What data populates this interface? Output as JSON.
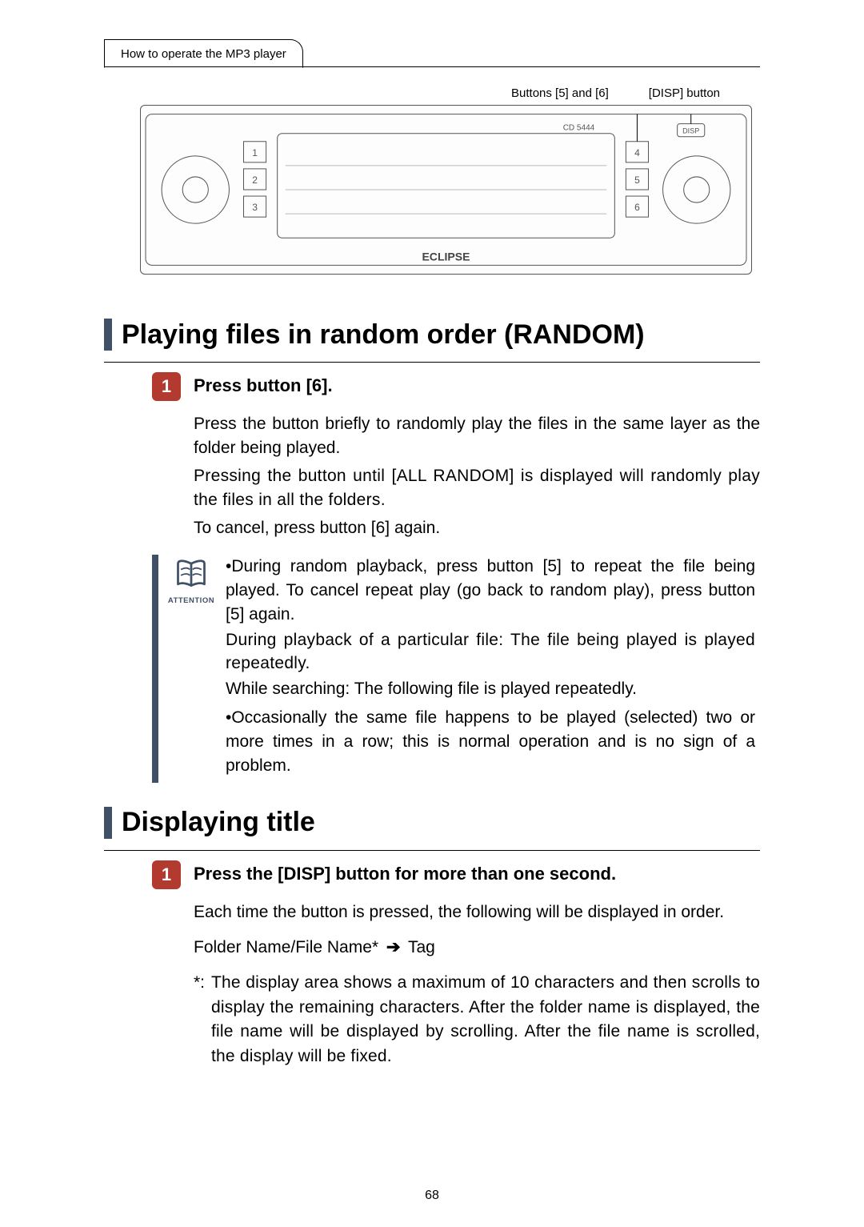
{
  "header": {
    "tab": "How to operate the MP3 player"
  },
  "diagram": {
    "callout_left": "Buttons [5] and [6]",
    "callout_right": "[DISP] button",
    "brand": "ECLIPSE",
    "model": "CD 5444"
  },
  "section1": {
    "heading": "Playing files in random order (RANDOM)",
    "step_num": "1",
    "step_title": "Press button [6].",
    "p1": "Press the button briefly to randomly play the files in the same layer as the folder being played.",
    "p2": "Pressing the button until [ALL RANDOM] is displayed will randomly play the files in all the folders.",
    "p3": "To cancel, press button [6] again.",
    "attention_label": "ATTENTION",
    "note_b1_lead": "•During random playback, press button [5] to repeat the file being played. To cancel repeat play (go back to random play), press button [5] again.",
    "note_b1_sub1": "During playback of a particular file: The file being played is played repeatedly.",
    "note_b1_sub2": "While searching: The following file is played repeatedly.",
    "note_b2": "•Occasionally the same file happens to be played (selected) two or more times in a row; this is normal operation and is no sign of a problem."
  },
  "section2": {
    "heading": "Displaying title",
    "step_num": "1",
    "step_title": "Press the [DISP] button for more than one second.",
    "p1": "Each time the button is pressed, the following will be displayed in order.",
    "seq_left": "Folder Name/File Name*",
    "seq_arrow": "➔",
    "seq_right": "Tag",
    "footnote_mark": "*:",
    "footnote_text": "The display area shows a maximum of 10 characters and then scrolls to display the remaining characters. After the folder name is displayed, the file name will be displayed by scrolling. After the file name is scrolled, the display will be fixed."
  },
  "page_number": "68"
}
